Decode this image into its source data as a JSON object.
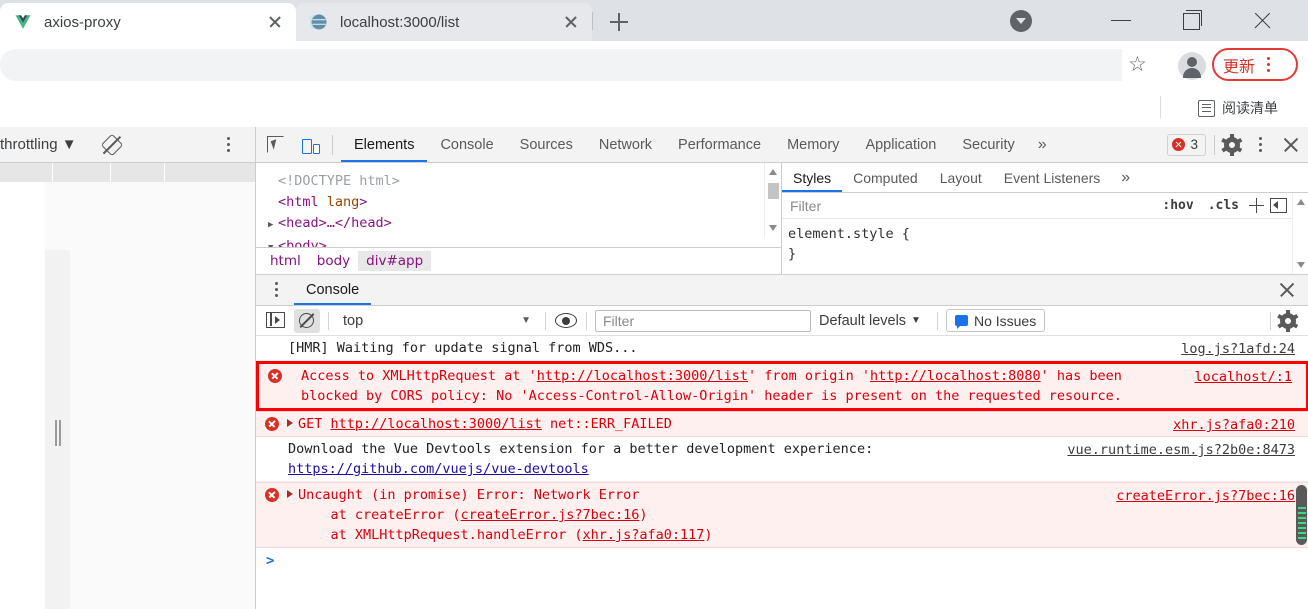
{
  "browser": {
    "tabs": [
      {
        "title": "axios-proxy",
        "favicon": "vue-logo-icon",
        "active": true
      },
      {
        "title": "localhost:3000/list",
        "favicon": "globe-icon",
        "active": false
      }
    ],
    "new_tab_label": "+",
    "window_controls": {
      "tab_search": "tab-search-icon",
      "minimize": "minimize-icon",
      "maximize": "maximize-icon",
      "close": "close-icon"
    },
    "toolbar": {
      "bookmark_star": "star-icon",
      "profile": "profile-avatar-icon",
      "update_label": "更新",
      "update_accent": "#d93025",
      "menu": "kebab-menu-icon"
    },
    "bookmarks_bar": {
      "reading_list_label": "阅读清单",
      "reading_list_icon": "reading-list-icon"
    }
  },
  "device_emulation": {
    "throttling_label": "throttling",
    "throttling_caret": "▼",
    "rotate_icon": "rotate-device-icon",
    "menu_icon": "kebab-menu-icon"
  },
  "devtools": {
    "main_tabs": [
      {
        "label": "Elements",
        "selected": true
      },
      {
        "label": "Console",
        "selected": false
      },
      {
        "label": "Sources",
        "selected": false
      },
      {
        "label": "Network",
        "selected": false
      },
      {
        "label": "Performance",
        "selected": false
      },
      {
        "label": "Memory",
        "selected": false
      },
      {
        "label": "Application",
        "selected": false
      },
      {
        "label": "Security",
        "selected": false
      }
    ],
    "more_tabs": "»",
    "error_count": "3",
    "inspect_icon": "inspect-element-icon",
    "device_toggle_icon": "device-toolbar-icon",
    "settings_icon": "gear-icon",
    "more_options_icon": "kebab-menu-icon",
    "close_icon": "close-icon",
    "elements": {
      "dom": {
        "line1": "<!DOCTYPE html>",
        "line2_tag": "<html",
        "line2_attr": " lang",
        "line2_close": ">",
        "line3": "<head>…</head>",
        "line4": "<body>"
      },
      "breadcrumbs": [
        {
          "label": "html",
          "selected": false
        },
        {
          "label": "body",
          "selected": false
        },
        {
          "label": "div#app",
          "selected": true
        }
      ]
    },
    "styles": {
      "tabs": [
        {
          "label": "Styles",
          "selected": true
        },
        {
          "label": "Computed",
          "selected": false
        },
        {
          "label": "Layout",
          "selected": false
        },
        {
          "label": "Event Listeners",
          "selected": false
        }
      ],
      "more_tabs": "»",
      "filter_placeholder": "Filter",
      "filter_value": "",
      "hov_label": ":hov",
      "cls_label": ".cls",
      "new_rule_icon": "plus-icon",
      "sidebar_toggle_icon": "toggle-sidebar-icon",
      "rule_open": "element.style {",
      "rule_close": "}"
    }
  },
  "drawer": {
    "menu_icon": "kebab-menu-icon",
    "tab_label": "Console",
    "close_icon": "close-icon",
    "toolbar": {
      "sidebar_icon": "console-sidebar-icon",
      "clear_icon": "clear-console-icon",
      "context_value": "top",
      "context_caret": "▼",
      "eye_icon": "live-expression-icon",
      "filter_placeholder": "Filter",
      "filter_value": "",
      "levels_label": "Default levels",
      "levels_caret": "▼",
      "issues_label": "No Issues",
      "issues_icon": "issues-icon",
      "settings_icon": "gear-icon"
    },
    "messages": [
      {
        "kind": "plain",
        "text": "[HMR] Waiting for update signal from WDS...",
        "source": "log.js?1afd:24"
      },
      {
        "kind": "error",
        "highlighted": true,
        "line1_pre": "Access to XMLHttpRequest at '",
        "line1_url1": "http://localhost:3000/list",
        "line1_mid": "' from origin '",
        "line1_url2": "http://localhost:8080",
        "line1_post": "' has been",
        "line2": "blocked by CORS policy: No 'Access-Control-Allow-Origin' header is present on the requested resource.",
        "source": "localhost/:1"
      },
      {
        "kind": "error",
        "expandable": true,
        "pre": "GET ",
        "url": "http://localhost:3000/list",
        "post": " net::ERR_FAILED",
        "source": "xhr.js?afa0:210"
      },
      {
        "kind": "plain",
        "line1": "Download the Vue Devtools extension for a better development experience:",
        "line2": "https://github.com/vuejs/vue-devtools",
        "source": "vue.runtime.esm.js?2b0e:8473"
      },
      {
        "kind": "error",
        "expandable": true,
        "line1": "Uncaught (in promise) Error: Network Error",
        "line2_pre": "    at createError (",
        "line2_link": "createError.js?7bec:16",
        "line2_post": ")",
        "line3_pre": "    at XMLHttpRequest.handleError (",
        "line3_link": "xhr.js?afa0:117",
        "line3_post": ")",
        "source": "createError.js?7bec:16"
      }
    ],
    "prompt_caret": ">"
  }
}
